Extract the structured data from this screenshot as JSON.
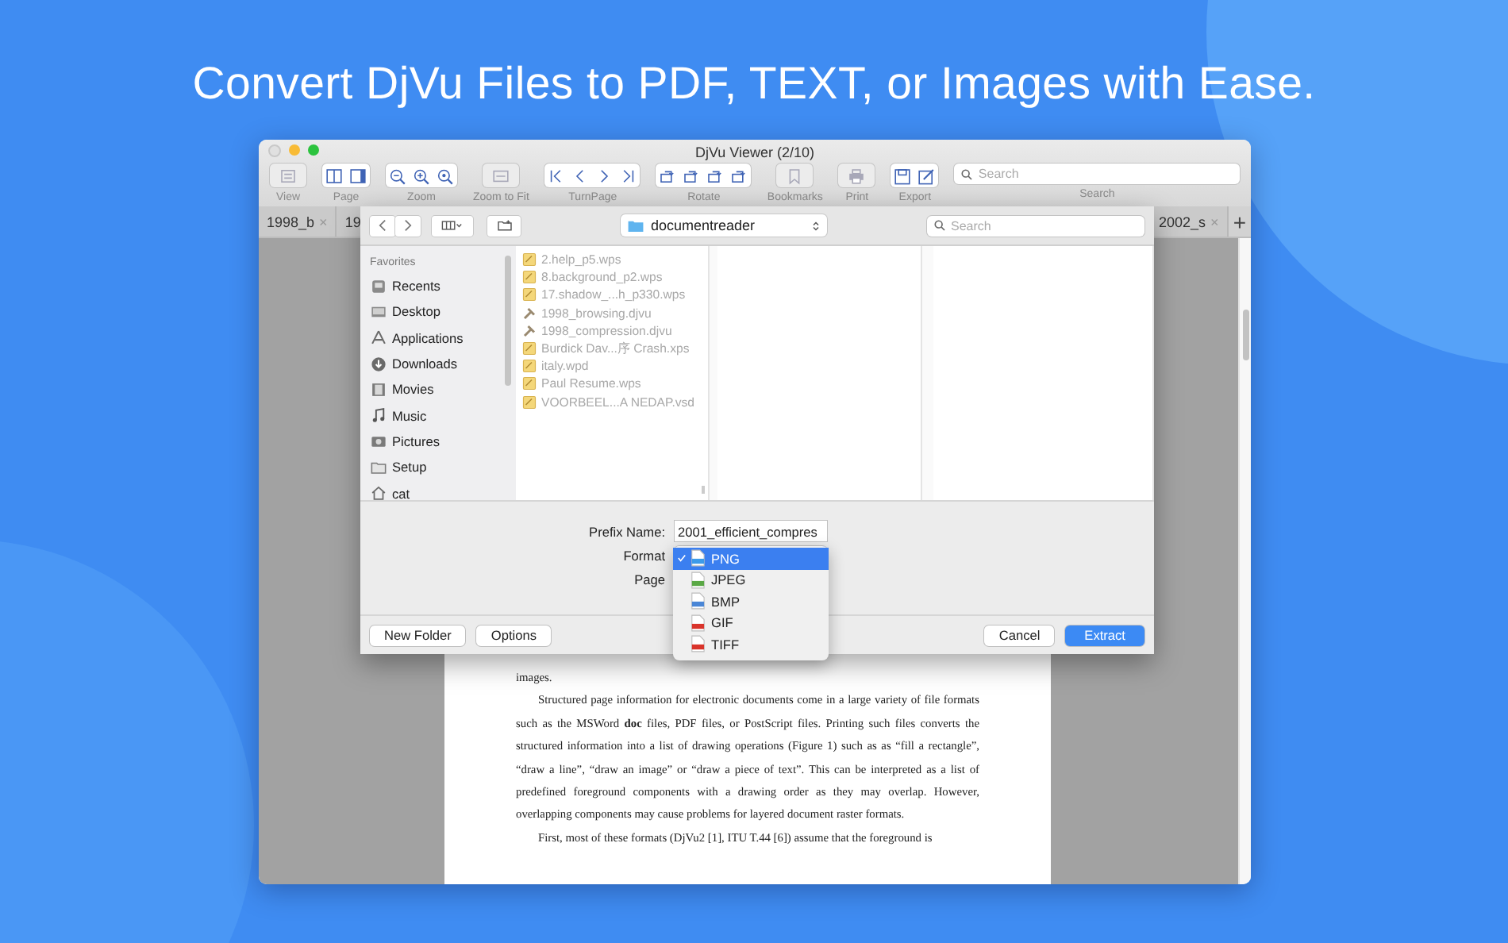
{
  "headline": "Convert DjVu Files to PDF, TEXT, or Images with Ease.",
  "window": {
    "title": "DjVu Viewer (2/10)"
  },
  "toolbar": {
    "groups": [
      {
        "label": "View",
        "disabled": true,
        "kind": "view"
      },
      {
        "label": "Page",
        "disabled": false,
        "kind": "page"
      },
      {
        "label": "Zoom",
        "disabled": false,
        "kind": "zoom"
      },
      {
        "label": "Zoom to Fit",
        "disabled": true,
        "kind": "fit"
      },
      {
        "label": "TurnPage",
        "disabled": false,
        "kind": "turnpage"
      },
      {
        "label": "Rotate",
        "disabled": false,
        "kind": "rotate"
      },
      {
        "label": "Bookmarks",
        "disabled": true,
        "kind": "bookmarks"
      },
      {
        "label": "Print",
        "disabled": true,
        "kind": "print"
      },
      {
        "label": "Export",
        "disabled": false,
        "kind": "export"
      }
    ],
    "search": {
      "placeholder": "Search",
      "label": "Search"
    }
  },
  "tabs": [
    {
      "label": "1998_b",
      "close": "×"
    },
    {
      "label": "19"
    }
  ],
  "tabs_right": [
    {
      "label": "2002_s",
      "close": "×"
    }
  ],
  "new_tab": "+",
  "dialog": {
    "location": "documentreader",
    "search_placeholder": "Search",
    "sidebar": {
      "heading": "Favorites",
      "items": [
        {
          "label": "Recents",
          "kind": "recents"
        },
        {
          "label": "Desktop",
          "kind": "desktop"
        },
        {
          "label": "Applications",
          "kind": "applications"
        },
        {
          "label": "Downloads",
          "kind": "downloads"
        },
        {
          "label": "Movies",
          "kind": "movies"
        },
        {
          "label": "Music",
          "kind": "music"
        },
        {
          "label": "Pictures",
          "kind": "pictures"
        },
        {
          "label": "Setup",
          "kind": "folder"
        },
        {
          "label": "cat",
          "kind": "home"
        }
      ]
    },
    "files": [
      {
        "name": "2.help_p5.wps",
        "kind": "document"
      },
      {
        "name": "8.background_p2.wps",
        "kind": "document"
      },
      {
        "name": "17.shadow_...h_p330.wps",
        "kind": "document"
      },
      {
        "name": "1998_browsing.djvu",
        "kind": "djvu"
      },
      {
        "name": "1998_compression.djvu",
        "kind": "djvu"
      },
      {
        "name": "Burdick Dav...序 Crash.xps",
        "kind": "document"
      },
      {
        "name": "italy.wpd",
        "kind": "document"
      },
      {
        "name": "Paul Resume.wps",
        "kind": "document"
      },
      {
        "name": "VOORBEEL...A NEDAP.vsd",
        "kind": "document"
      }
    ],
    "prefix": {
      "label": "Prefix Name:",
      "value": "2001_efficient_compres"
    },
    "format_label": "Format",
    "page_label": "Page",
    "format_menu": [
      {
        "label": "PNG",
        "color": "#3d9be9",
        "selected": true
      },
      {
        "label": "JPEG",
        "color": "#5aa845",
        "selected": false
      },
      {
        "label": "BMP",
        "color": "#4a86d6",
        "selected": false
      },
      {
        "label": "GIF",
        "color": "#d9342b",
        "selected": false
      },
      {
        "label": "TIFF",
        "color": "#d9342b",
        "selected": false
      }
    ],
    "buttons": [
      "New Folder",
      "Options"
    ],
    "buttons_right": [
      {
        "label": "Cancel",
        "kind": "normal"
      },
      {
        "label": "Extract",
        "kind": "primary"
      }
    ]
  },
  "document": {
    "paragraphs": [
      {
        "text": "images.",
        "kind": "continuation"
      },
      {
        "text": "Structured page information for electronic documents come in a large variety of file formats such as the MSWord **doc** files, PDF files, or PostScript files.  Printing such files converts the structured information into a list of drawing operations (Figure 1) such as as “fill a rectangle”, “draw a line”, “draw an image” or “draw a piece of text”.  This can be interpreted as a list of predefined foreground components with a drawing order as they may overlap. However, overlapping components may cause problems for layered document raster formats.",
        "kind": "paragraph"
      },
      {
        "text": "First, most of these formats (DjVu2 [1], ITU T.44 [6]) assume that the foreground is",
        "kind": "paragraph"
      }
    ]
  }
}
